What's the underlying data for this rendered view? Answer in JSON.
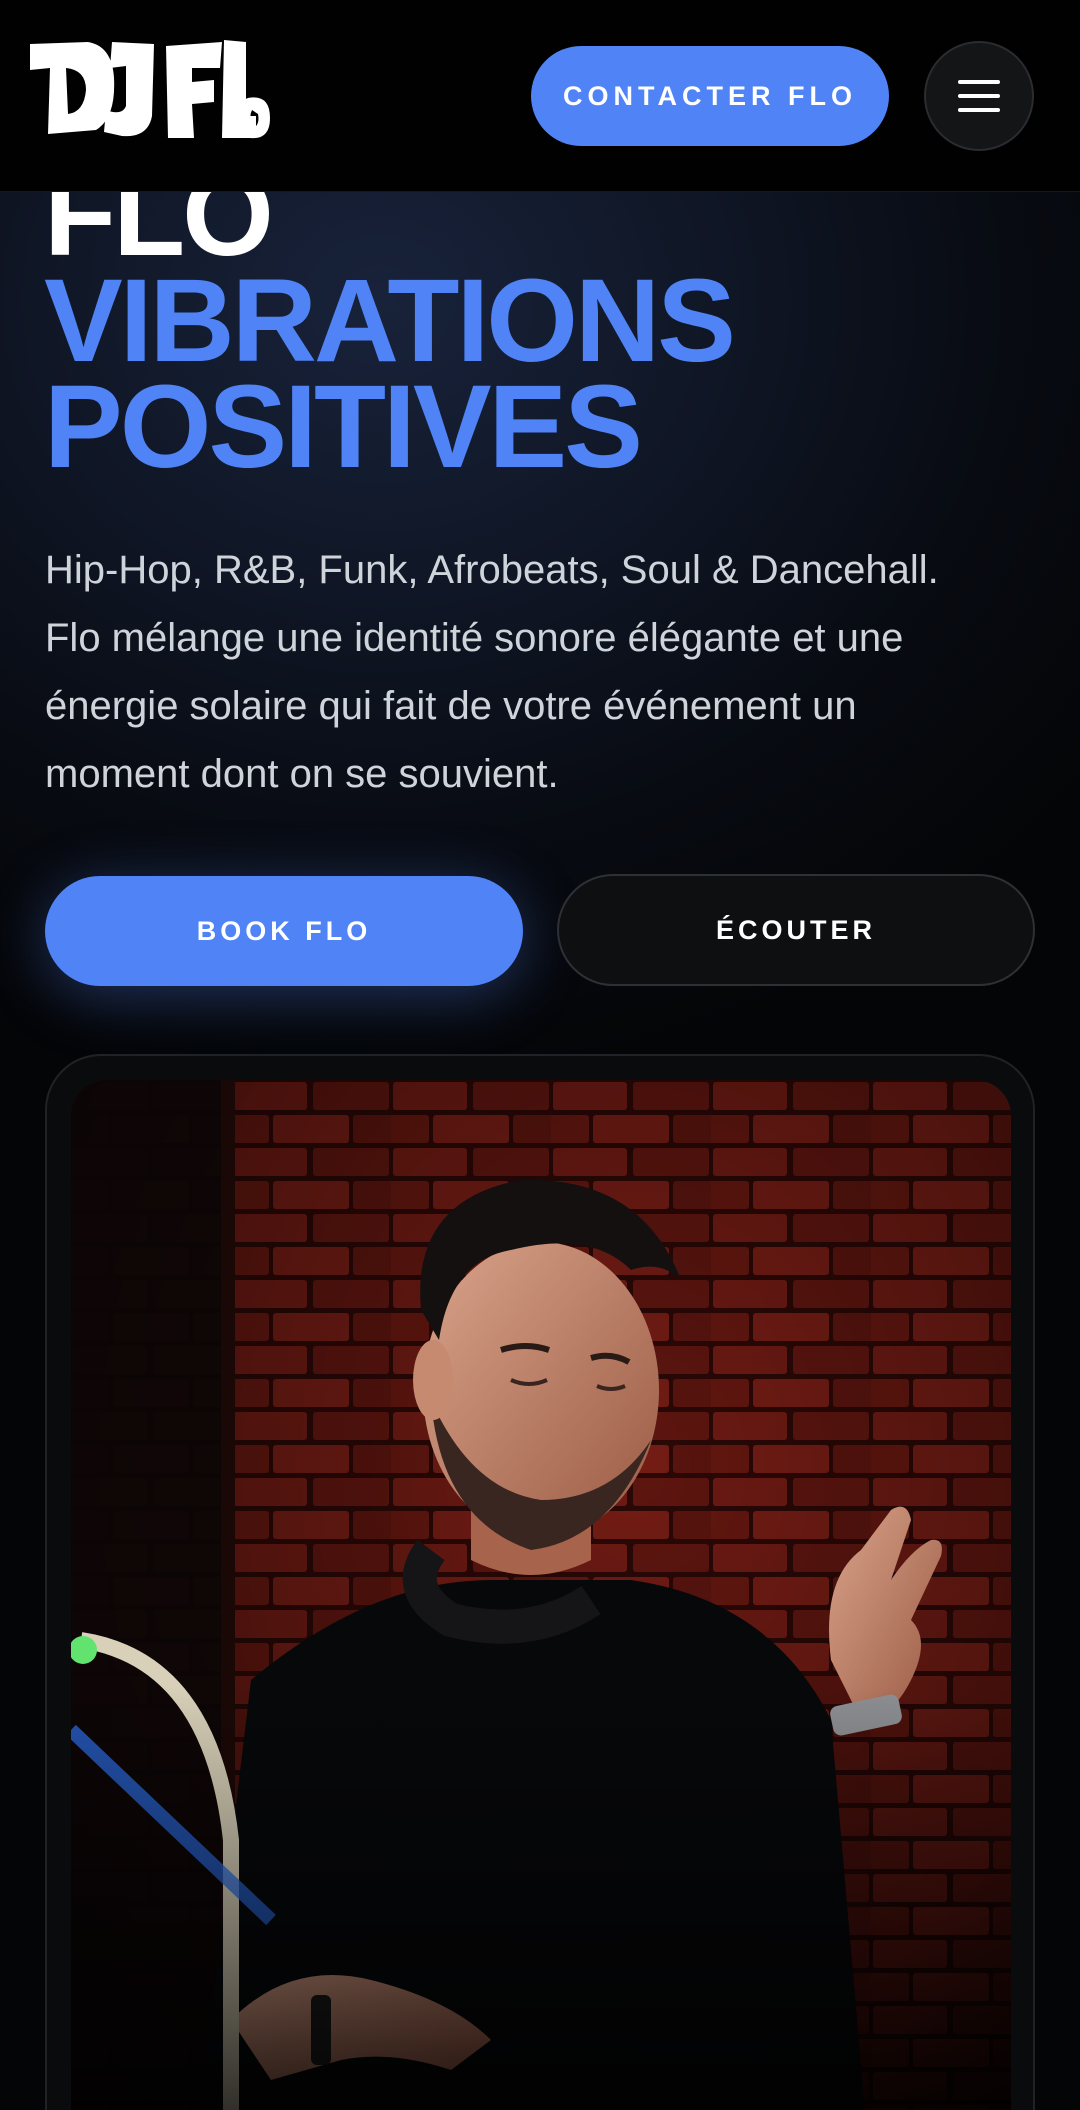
{
  "header": {
    "logo_text": "DJ FLO",
    "contact_label": "CONTACTER FLO",
    "menu_icon": "hamburger-menu-icon"
  },
  "hero": {
    "title_line1": "FLO",
    "title_line2": "VIBRATIONS",
    "title_line3": "POSITIVES",
    "description": "Hip-Hop, R&B, Funk, Afrobeats, Soul & Dancehall. Flo mélange une identité sonore élégante et une énergie solaire qui fait de votre événement un moment dont on se souvient.",
    "book_label": "BOOK FLO",
    "listen_label": "ÉCOUTER"
  },
  "photo": {
    "subject": "dj-portrait-photo"
  },
  "colors": {
    "accent": "#4f83f6",
    "background": "#040507",
    "header": "#010101",
    "brick": "#6a1712"
  }
}
